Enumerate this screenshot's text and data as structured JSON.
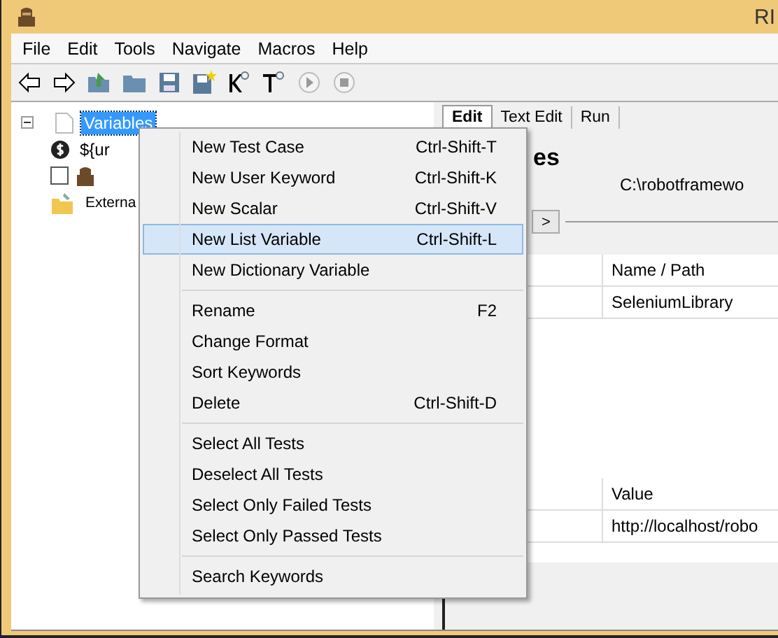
{
  "window": {
    "title": "RI"
  },
  "menu_bar": [
    "File",
    "Edit",
    "Tools",
    "Navigate",
    "Macros",
    "Help"
  ],
  "tree": {
    "root": {
      "label": "Variables",
      "selected": true,
      "expanded": true,
      "children": [
        {
          "label": "${ur",
          "kind": "variable"
        },
        {
          "kind": "test",
          "checked": false
        }
      ]
    },
    "external": {
      "label": "Externa"
    }
  },
  "tabs": [
    {
      "label": "Edit",
      "selected": true
    },
    {
      "label": "Text Edit",
      "selected": false
    },
    {
      "label": "Run",
      "selected": false
    }
  ],
  "editor": {
    "heading": "es",
    "path": "C:\\robotframewo",
    "button": ">",
    "imports": {
      "columns": [
        "Name / Path"
      ],
      "rows": [
        [
          "SeleniumLibrary"
        ]
      ]
    },
    "variables": {
      "columns": [
        "Value"
      ],
      "rows": [
        [
          "http://localhost/robo"
        ]
      ]
    }
  },
  "context_menu": {
    "groups": [
      [
        {
          "label": "New Test Case",
          "shortcut": "Ctrl-Shift-T",
          "selected": false
        },
        {
          "label": "New User Keyword",
          "shortcut": "Ctrl-Shift-K",
          "selected": false
        },
        {
          "label": "New Scalar",
          "shortcut": "Ctrl-Shift-V",
          "selected": false
        },
        {
          "label": "New List Variable",
          "shortcut": "Ctrl-Shift-L",
          "selected": true
        },
        {
          "label": "New Dictionary Variable",
          "selected": false
        }
      ],
      [
        {
          "label": "Rename",
          "shortcut": "F2",
          "selected": false
        },
        {
          "label": "Change Format",
          "selected": false
        },
        {
          "label": "Sort Keywords",
          "selected": false
        },
        {
          "label": "Delete",
          "shortcut": "Ctrl-Shift-D",
          "selected": false
        }
      ],
      [
        {
          "label": "Select All Tests",
          "selected": false
        },
        {
          "label": "Deselect All Tests",
          "selected": false
        },
        {
          "label": "Select Only Failed Tests",
          "selected": false
        },
        {
          "label": "Select Only Passed Tests",
          "selected": false
        }
      ],
      [
        {
          "label": "Search Keywords",
          "selected": false
        }
      ]
    ]
  }
}
